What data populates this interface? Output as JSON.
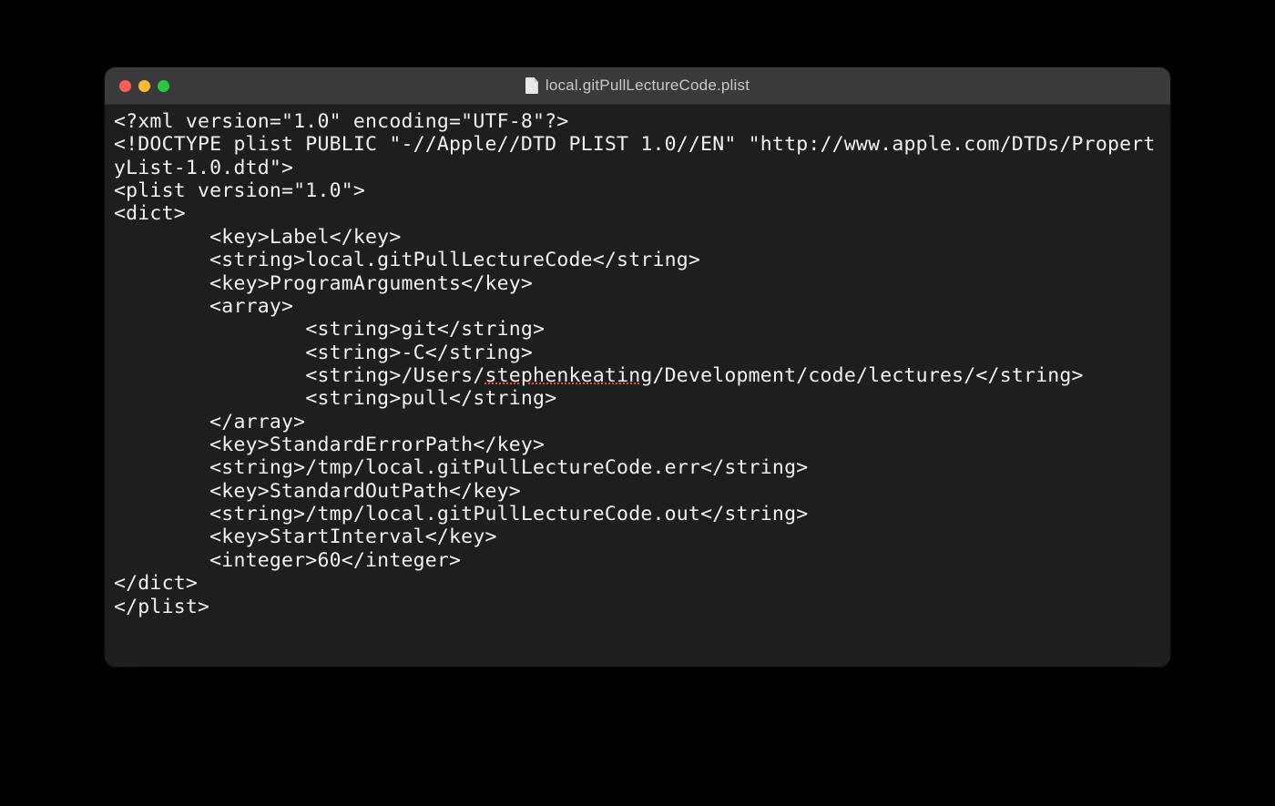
{
  "window": {
    "title": "local.gitPullLectureCode.plist"
  },
  "code": {
    "lines": [
      "<?xml version=\"1.0\" encoding=\"UTF-8\"?>",
      "<!DOCTYPE plist PUBLIC \"-//Apple//DTD PLIST 1.0//EN\" \"http://www.apple.com/DTDs/PropertyList-1.0.dtd\">",
      "<plist version=\"1.0\">",
      "<dict>",
      "        <key>Label</key>",
      "        <string>local.gitPullLectureCode</string>",
      "        <key>ProgramArguments</key>",
      "        <array>",
      "                <string>git</string>",
      "                <string>-C</string>",
      "                <string>/Users/stephenkeating/Development/code/lectures/</string>",
      "                <string>pull</string>",
      "        </array>",
      "        <key>StandardErrorPath</key>",
      "        <string>/tmp/local.gitPullLectureCode.err</string>",
      "        <key>StandardOutPath</key>",
      "        <string>/tmp/local.gitPullLectureCode.out</string>",
      "        <key>StartInterval</key>",
      "        <integer>60</integer>",
      "</dict>",
      "</plist>"
    ],
    "spellcheck_word": "stephenkeating"
  }
}
